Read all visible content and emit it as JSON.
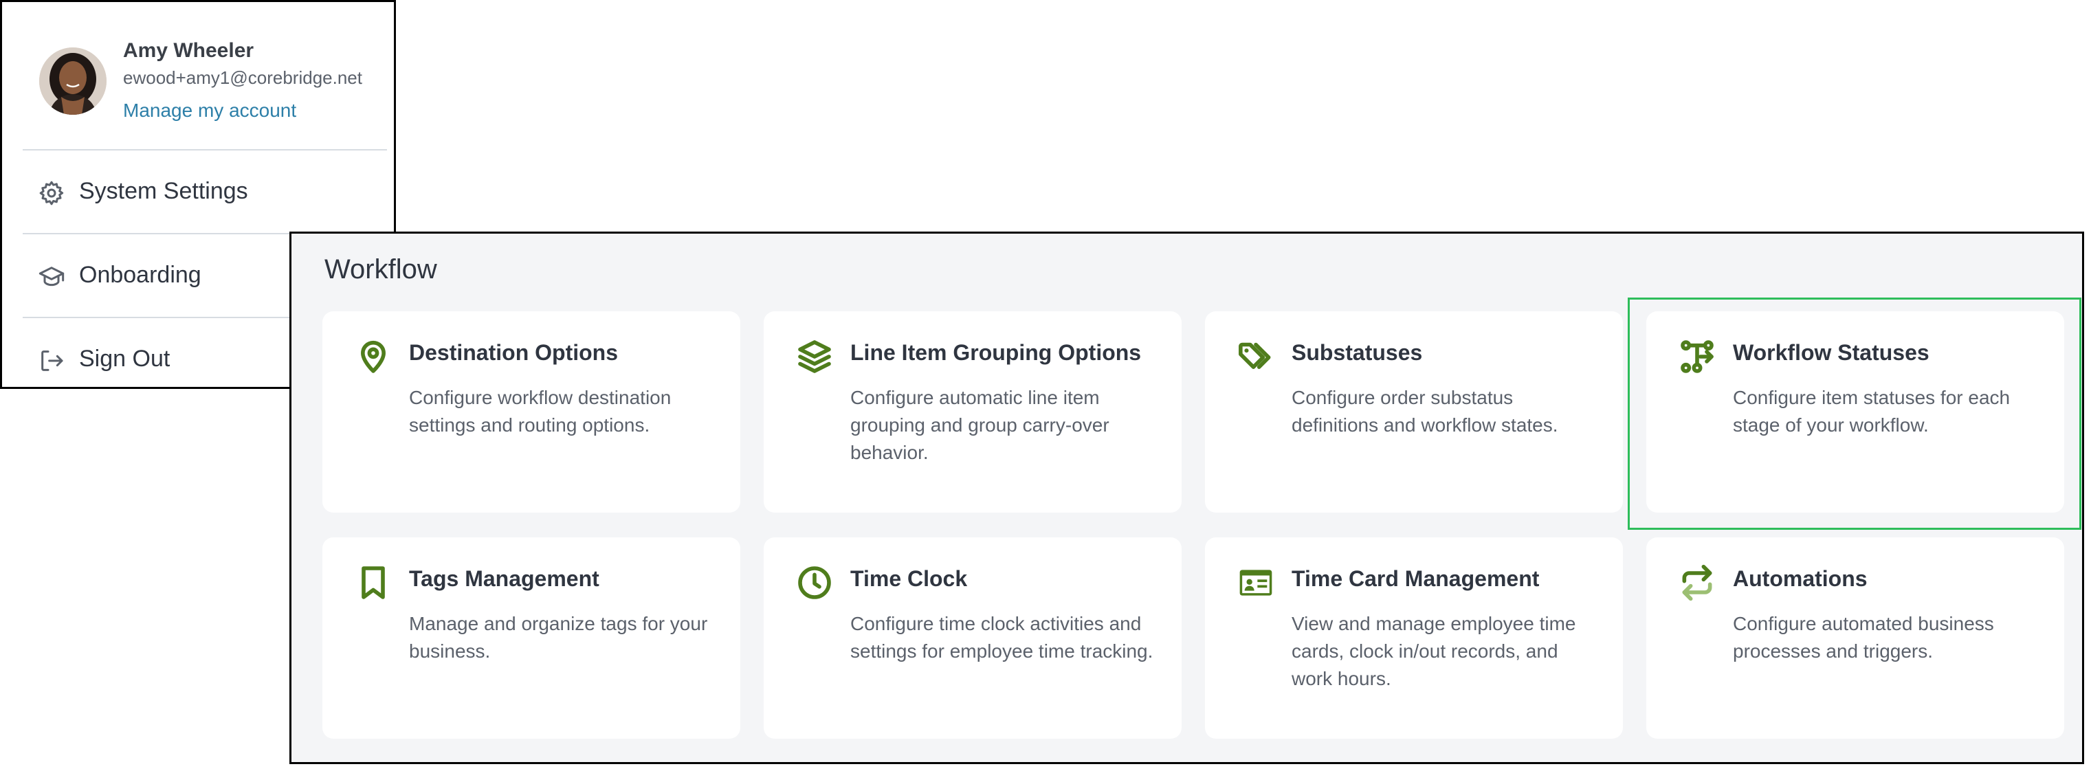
{
  "account_menu": {
    "user_name": "Amy Wheeler",
    "user_email": "ewood+amy1@corebridge.net",
    "manage_link": "Manage my account",
    "items": [
      {
        "label": "System Settings",
        "icon": "gear-icon"
      },
      {
        "label": "Onboarding",
        "icon": "graduation-cap-icon"
      },
      {
        "label": "Sign Out",
        "icon": "sign-out-icon"
      }
    ]
  },
  "workflow": {
    "title": "Workflow",
    "accent_color": "#4f7d1c",
    "highlight_color": "#2ebd5b",
    "cards": [
      {
        "title": "Destination Options",
        "description": "Configure workflow destination settings and routing options.",
        "icon": "map-pin-icon"
      },
      {
        "title": "Line Item Grouping Options",
        "description": "Configure automatic line item grouping and group carry-over behavior.",
        "icon": "layers-icon"
      },
      {
        "title": "Substatuses",
        "description": "Configure order substatus definitions and workflow states.",
        "icon": "tags-icon"
      },
      {
        "title": "Workflow Statuses",
        "description": "Configure item statuses for each stage of your workflow.",
        "icon": "workflow-icon"
      },
      {
        "title": "Tags Management",
        "description": "Manage and organize tags for your business.",
        "icon": "bookmark-icon"
      },
      {
        "title": "Time Clock",
        "description": "Configure time clock activities and settings for employee time tracking.",
        "icon": "clock-icon"
      },
      {
        "title": "Time Card Management",
        "description": "View and manage employee time cards, clock in/out records, and work hours.",
        "icon": "id-card-icon"
      },
      {
        "title": "Automations",
        "description": "Configure automated business processes and triggers.",
        "icon": "repeat-icon"
      }
    ]
  }
}
